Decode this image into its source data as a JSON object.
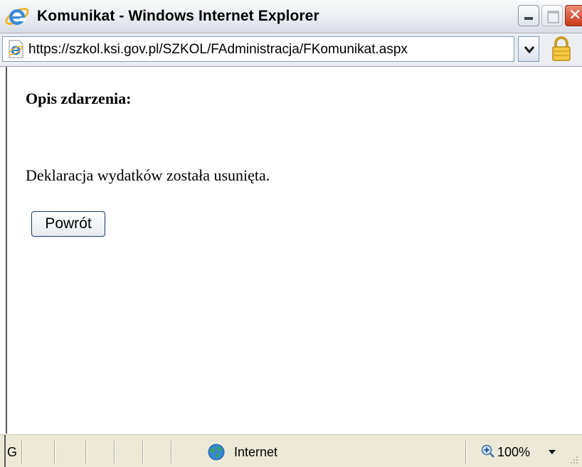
{
  "window": {
    "title": "Komunikat - Windows Internet Explorer"
  },
  "address_bar": {
    "url": "https://szkol.ksi.gov.pl/SZKOL/FAdministracja/FKomunikat.aspx"
  },
  "content": {
    "heading": "Opis zdarzenia:",
    "message": "Deklaracja wydatków została usunięta.",
    "back_button_label": "Powrót"
  },
  "status_bar": {
    "status_text": "G",
    "zone": "Internet",
    "zoom": "100%"
  },
  "icons": {
    "title_icon": "ie-logo-icon",
    "page_icon": "ie-page-icon",
    "security_icon": "lock-icon",
    "zone_icon": "globe-icon",
    "zoom_icon": "zoom-icon"
  },
  "colors": {
    "close_button": "#c9381b",
    "button_border": "#1c3a6e"
  }
}
